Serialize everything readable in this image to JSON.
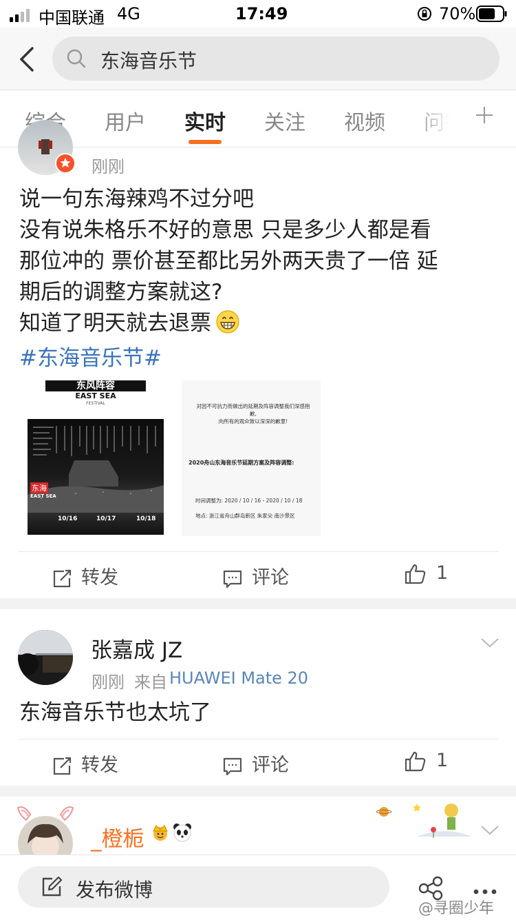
{
  "status_bar": {
    "carrier": "中国联通",
    "network": "4G",
    "time": "17:49",
    "battery": "70%",
    "battery_level": 0.7
  },
  "header": {
    "search_query": "东海音乐节"
  },
  "tabs": [
    {
      "label": "综合",
      "active": false
    },
    {
      "label": "用户",
      "active": false
    },
    {
      "label": "实时",
      "active": true
    },
    {
      "label": "关注",
      "active": false
    },
    {
      "label": "视频",
      "active": false
    },
    {
      "label": "问答",
      "active": false
    }
  ],
  "accent_color": "#f76f1f",
  "link_color": "#3b73b9",
  "posts": [
    {
      "time": "刚刚",
      "lines": [
        "说一句东海辣鸡不过分吧",
        "没有说朱格乐不好的意思 只是多少人都是看",
        "那位冲的 票价甚至都比另外两天贵了一倍 延",
        "期后的调整方案就这?",
        "知道了明天就去退票"
      ],
      "emoji": "grinning-face-emoji",
      "topic": "#东海音乐节#",
      "images": [
        {
          "title": "东风阵容",
          "brand": "EAST SEA",
          "subbrand": "FESTIVAL",
          "badge_cn": "东海",
          "badge_en": "EAST SEA",
          "dates": [
            "10/16",
            "10/17",
            "10/18"
          ]
        },
        {
          "lines": [
            "对因不可抗力而做出的延期及阵容调整我们深感抱",
            "歉,",
            "向所有的观众致以深深的歉意!",
            "2020舟山东海音乐节延期方案及阵容调整:",
            "时间调整为: 2020 / 10 / 16 - 2020 / 10 / 18",
            "地点: 浙江省舟山群岛新区 朱家尖 南沙景区"
          ]
        }
      ],
      "actions": {
        "repost": "转发",
        "comment": "评论",
        "like_count": "1"
      }
    },
    {
      "username": "张嘉成 JZ",
      "time": "刚刚",
      "source_prefix": "来自",
      "source": "HUAWEI Mate 20",
      "text": "东海音乐节也太坑了",
      "actions": {
        "repost": "转发",
        "comment": "评论",
        "like_count": "1"
      }
    },
    {
      "username": "_橙栀",
      "badges": [
        "crown-emoji",
        "panda-emoji"
      ]
    }
  ],
  "bottom_bar": {
    "compose_label": "发布微博"
  },
  "watermark": "@寻圈少年"
}
